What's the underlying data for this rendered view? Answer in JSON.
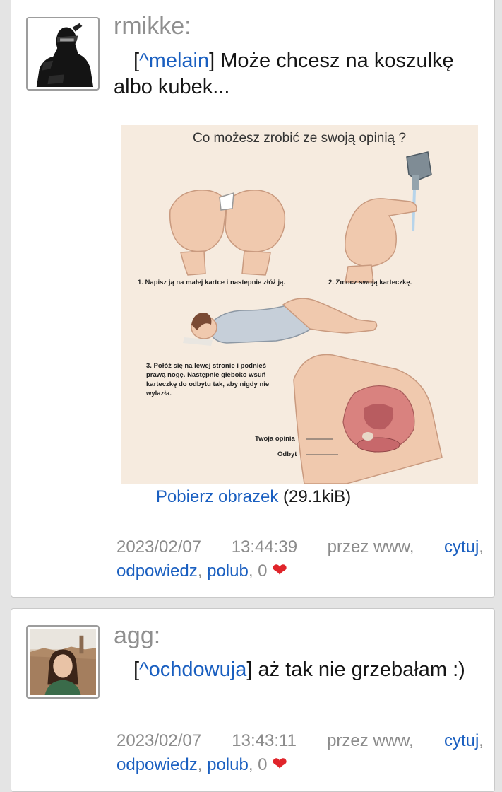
{
  "posts": [
    {
      "author": "rmikke:",
      "reply_tag": "^melain",
      "message": " Może chcesz na koszulkę albo kubek...",
      "image": {
        "title": "Co możesz zrobić ze swoją opinią ?",
        "caption1": "1. Napisz ją na małej kartce i nastepnie złóż ją.",
        "caption2": "2. Zmocz swoją karteczkę.",
        "caption3": "3. Połóż się na lewej stronie i podnieś prawą nogę. Następnie głęboko wsuń karteczkę do odbytu tak, aby nigdy nie wylazła.",
        "label_opinion": "Twoja opinia",
        "label_anus": "Odbyt"
      },
      "download_label": "Pobierz obrazek",
      "download_size": "(29.1kiB)",
      "date": "2023/02/07",
      "time": "13:44:39",
      "via": "przez www,",
      "quote_label": "cytuj",
      "reply_label": "odpowiedz",
      "like_label": "polub",
      "like_count": "0"
    },
    {
      "author": "agg:",
      "reply_tag": "^ochdowuja",
      "message": " aż tak nie grzebałam :)",
      "date": "2023/02/07",
      "time": "13:43:11",
      "via": "przez www,",
      "quote_label": "cytuj",
      "reply_label": "odpowiedz",
      "like_label": "polub",
      "like_count": "0"
    }
  ],
  "icons": {
    "heart": "❤"
  },
  "colors": {
    "link": "#1a5fc0",
    "meta": "#8c8c8c",
    "author": "#8f8f8f",
    "heart": "#e0242a"
  }
}
